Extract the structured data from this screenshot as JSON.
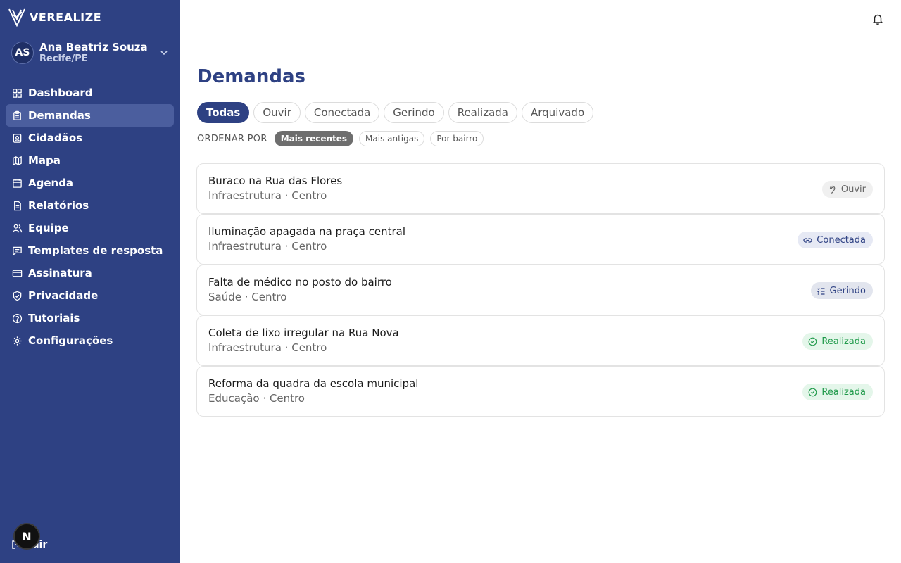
{
  "brand": {
    "name": "VEREALIZE"
  },
  "user": {
    "initials": "AS",
    "name": "Ana Beatriz Souza",
    "location": "Recife/PE"
  },
  "nav": [
    {
      "label": "Dashboard",
      "icon": "dashboard-icon"
    },
    {
      "label": "Demandas",
      "icon": "clipboard-icon",
      "active": true
    },
    {
      "label": "Cidadãos",
      "icon": "contact-card-icon"
    },
    {
      "label": "Mapa",
      "icon": "map-icon"
    },
    {
      "label": "Agenda",
      "icon": "calendar-icon"
    },
    {
      "label": "Relatórios",
      "icon": "report-icon"
    },
    {
      "label": "Equipe",
      "icon": "team-icon"
    },
    {
      "label": "Templates de resposta",
      "icon": "message-icon"
    },
    {
      "label": "Assinatura",
      "icon": "credit-card-icon"
    },
    {
      "label": "Privacidade",
      "icon": "shield-icon"
    },
    {
      "label": "Tutoriais",
      "icon": "help-circle-icon"
    },
    {
      "label": "Configurações",
      "icon": "gear-icon"
    }
  ],
  "logout": {
    "label": "Sair"
  },
  "dev_badge": {
    "label": "N"
  },
  "page": {
    "title": "Demandas"
  },
  "filters": [
    "Todas",
    "Ouvir",
    "Conectada",
    "Gerindo",
    "Realizada",
    "Arquivado"
  ],
  "sort": {
    "label": "ORDENAR POR",
    "options": [
      "Mais recentes",
      "Mais antigas",
      "Por bairro"
    ]
  },
  "demands": [
    {
      "title": "Buraco na Rua das Flores",
      "subtitle": "Infraestrutura · Centro",
      "status": "Ouvir"
    },
    {
      "title": "Iluminação apagada na praça central",
      "subtitle": "Infraestrutura · Centro",
      "status": "Conectada"
    },
    {
      "title": "Falta de médico no posto do bairro",
      "subtitle": "Saúde · Centro",
      "status": "Gerindo"
    },
    {
      "title": "Coleta de lixo irregular na Rua Nova",
      "subtitle": "Infraestrutura · Centro",
      "status": "Realizada"
    },
    {
      "title": "Reforma da quadra da escola municipal",
      "subtitle": "Educação · Centro",
      "status": "Realizada"
    }
  ],
  "colors": {
    "sidebar": "#2e4183",
    "accent": "#2e4183",
    "success": "#1f9a4a"
  }
}
